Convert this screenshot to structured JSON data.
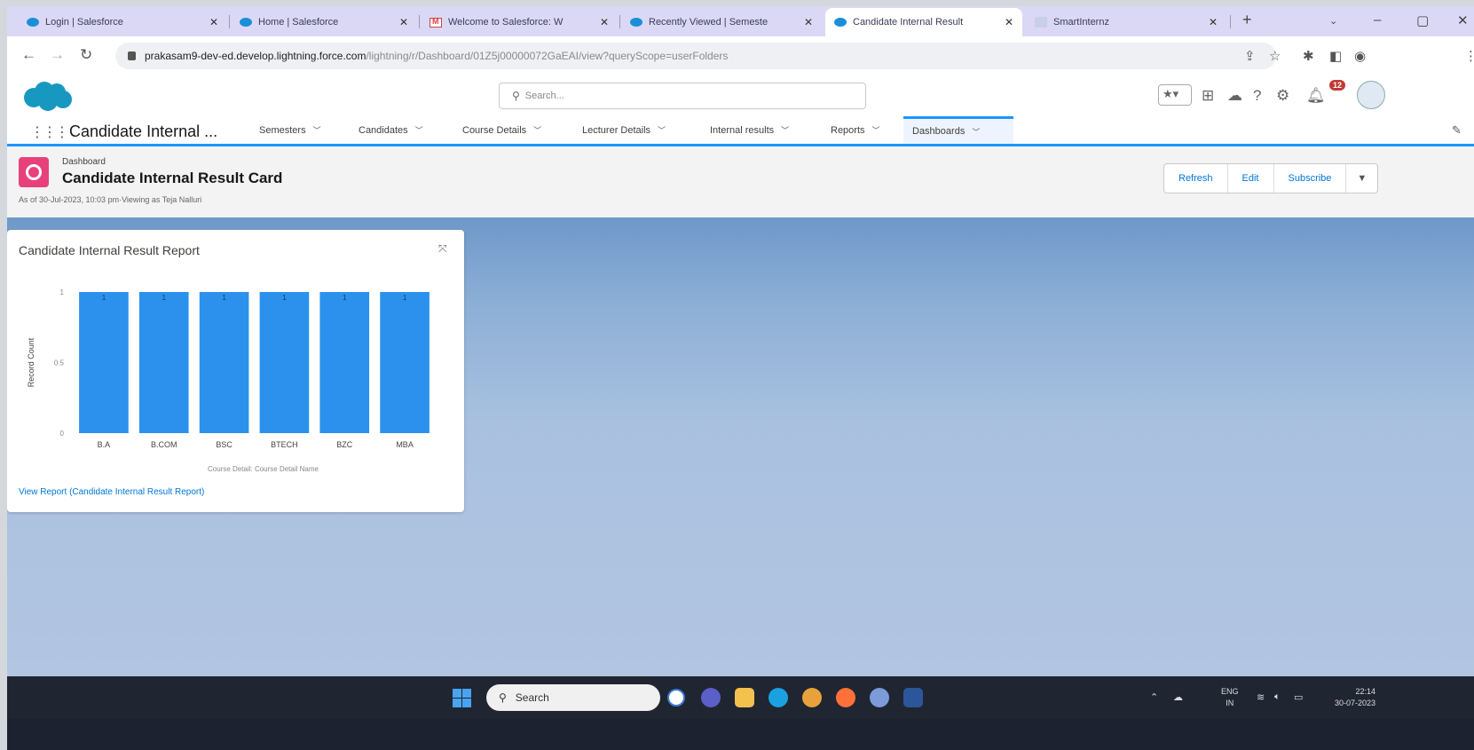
{
  "browser": {
    "tabs": [
      {
        "label": "Login | Salesforce",
        "icon": "salesforce-cloud-icon",
        "active": false
      },
      {
        "label": "Home | Salesforce",
        "icon": "salesforce-cloud-icon",
        "active": false
      },
      {
        "label": "Welcome to Salesforce: W",
        "icon": "gmail-icon",
        "active": false
      },
      {
        "label": "Recently Viewed | Semeste",
        "icon": "salesforce-cloud-icon",
        "active": false
      },
      {
        "label": "Candidate Internal Result",
        "icon": "salesforce-cloud-icon",
        "active": true
      },
      {
        "label": "SmartInternz",
        "icon": "smartinternz-icon",
        "active": false
      }
    ],
    "close_glyph": "✕",
    "new_tab_glyph": "+",
    "url_host": "prakasam9-dev-ed.develop.lightning.force.com",
    "url_path": "/lightning/r/Dashboard/01Z5j00000072GaEAI/view?queryScope=userFolders"
  },
  "sf_header": {
    "search_placeholder": "Search...",
    "notification_count": "12"
  },
  "nav": {
    "app_name": "Candidate Internal ...",
    "items": [
      {
        "label": "Semesters"
      },
      {
        "label": "Candidates"
      },
      {
        "label": "Course Details"
      },
      {
        "label": "Lecturer Details"
      },
      {
        "label": "Internal results"
      },
      {
        "label": "Reports"
      },
      {
        "label": "Dashboards"
      }
    ],
    "active_item": "Dashboards"
  },
  "page_header": {
    "object_label": "Dashboard",
    "title": "Candidate Internal Result Card",
    "as_of": "As of 30-Jul-2023, 10:03 pm·Viewing as Teja Nalluri",
    "buttons": {
      "refresh": "Refresh",
      "edit": "Edit",
      "subscribe": "Subscribe"
    }
  },
  "component": {
    "title": "Candidate Internal Result Report",
    "view_report_link": "View Report (Candidate Internal Result Report)"
  },
  "chart_data": {
    "type": "bar",
    "categories": [
      "B.A",
      "B.COM",
      "BSC",
      "BTECH",
      "BZC",
      "MBA"
    ],
    "values": [
      1,
      1,
      1,
      1,
      1,
      1
    ],
    "data_labels": [
      "1",
      "1",
      "1",
      "1",
      "1",
      "1"
    ],
    "ylabel": "Record Count",
    "xlabel": "Course Detail: Course Detail Name",
    "yticks": [
      "0",
      "0.5",
      "1"
    ],
    "ylim": [
      0,
      1
    ],
    "bar_color": "#2b91ed",
    "grid": false
  },
  "taskbar": {
    "search_label": "Search",
    "lang_line1": "ENG",
    "lang_line2": "IN",
    "time": "22:14",
    "date": "30-07-2023"
  },
  "colors": {
    "brand_blue": "#0176d3",
    "dashboard_icon": "#e8407a",
    "nav_accent": "#1b96ff"
  }
}
